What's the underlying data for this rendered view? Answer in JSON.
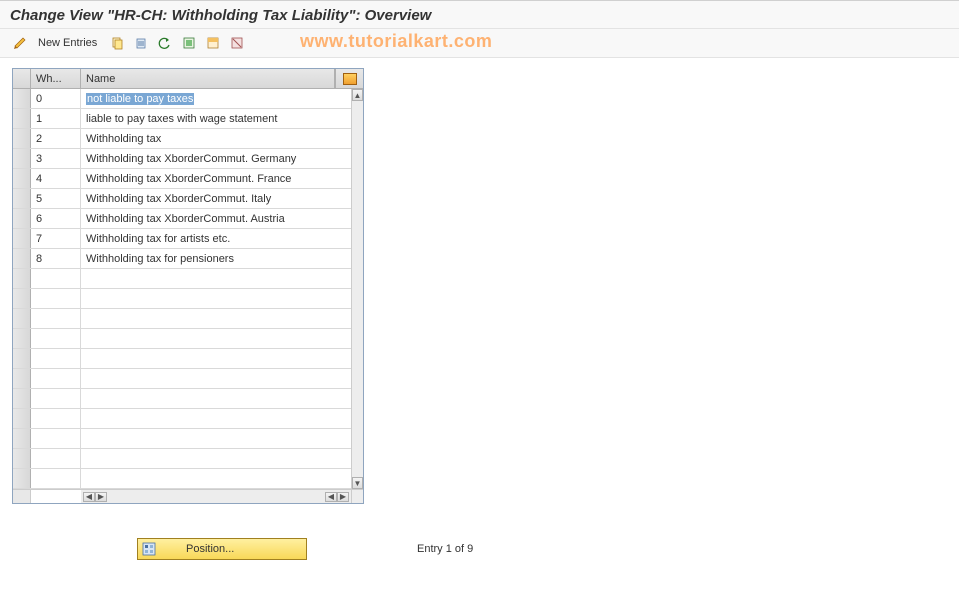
{
  "title": "Change View \"HR-CH: Withholding Tax Liability\": Overview",
  "toolbar": {
    "new_entries": "New Entries"
  },
  "watermark": "www.tutorialkart.com",
  "table": {
    "col_wh": "Wh...",
    "col_name": "Name",
    "rows": [
      {
        "wh": "0",
        "name": "not liable to pay taxes",
        "selected": true
      },
      {
        "wh": "1",
        "name": "liable to pay taxes with wage statement"
      },
      {
        "wh": "2",
        "name": "Withholding tax"
      },
      {
        "wh": "3",
        "name": "Withholding tax XborderCommut. Germany"
      },
      {
        "wh": "4",
        "name": "Withholding tax XborderCommunt. France"
      },
      {
        "wh": "5",
        "name": "Withholding tax XborderCommut. Italy"
      },
      {
        "wh": "6",
        "name": "Withholding tax XborderCommut. Austria"
      },
      {
        "wh": "7",
        "name": "Withholding tax for artists etc."
      },
      {
        "wh": "8",
        "name": "Withholding tax for pensioners"
      }
    ],
    "empty_rows": 11
  },
  "footer": {
    "position_label": "Position...",
    "entry_status": "Entry 1 of 9"
  }
}
